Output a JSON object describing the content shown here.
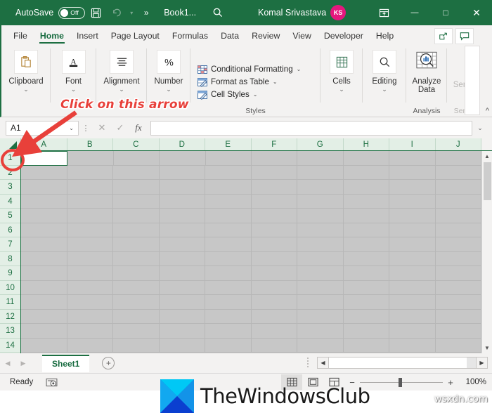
{
  "titlebar": {
    "autosave_label": "AutoSave",
    "autosave_state": "Off",
    "save_icon": "save-icon",
    "undo_icon": "undo-icon",
    "more_icon": "more-commands-icon",
    "document_name": "Book1...",
    "search_icon": "search-icon",
    "user_name": "Komal Srivastava",
    "avatar_initials": "KS",
    "avatar_color": "#e5177e",
    "ribbon_display_icon": "ribbon-display-options-icon",
    "minimize": "—",
    "maximize": "□",
    "close": "✕",
    "background": "#1d6f42"
  },
  "tabs": [
    {
      "label": "File",
      "active": false
    },
    {
      "label": "Home",
      "active": true
    },
    {
      "label": "Insert",
      "active": false
    },
    {
      "label": "Page Layout",
      "active": false
    },
    {
      "label": "Formulas",
      "active": false
    },
    {
      "label": "Data",
      "active": false
    },
    {
      "label": "Review",
      "active": false
    },
    {
      "label": "View",
      "active": false
    },
    {
      "label": "Developer",
      "active": false
    },
    {
      "label": "Help",
      "active": false
    }
  ],
  "tabbar_actions": [
    {
      "name": "share-button",
      "icon": "share-icon"
    },
    {
      "name": "comments-button",
      "icon": "comment-icon"
    }
  ],
  "ribbon": {
    "groups": [
      {
        "label": "Clipboard",
        "icon": "clipboard-icon",
        "group_name": "",
        "chevron": "⌄"
      },
      {
        "label": "Font",
        "icon": "font-a-icon",
        "group_name": "",
        "chevron": "⌄"
      },
      {
        "label": "Alignment",
        "icon": "alignment-icon",
        "group_name": "",
        "chevron": "⌄"
      },
      {
        "label": "Number",
        "icon": "percent-icon",
        "group_name": "",
        "chevron": "⌄"
      }
    ],
    "styles": {
      "group_name": "Styles",
      "items": [
        {
          "label": "Conditional Formatting",
          "icon": "conditional-formatting-icon",
          "chevron": "⌄"
        },
        {
          "label": "Format as Table",
          "icon": "format-as-table-icon",
          "chevron": "⌄"
        },
        {
          "label": "Cell Styles",
          "icon": "cell-styles-icon",
          "chevron": "⌄"
        }
      ]
    },
    "cells": {
      "label": "Cells",
      "icon": "cells-icon",
      "chevron": "⌄"
    },
    "editing": {
      "label": "Editing",
      "icon": "editing-find-icon",
      "chevron": "⌄"
    },
    "analysis": {
      "label": "Analyze Data",
      "icon": "analyze-data-icon",
      "group_name": "Analysis"
    },
    "sensitivity": {
      "label": "Sen",
      "group_name": "Sen",
      "overflow_chevron": "›"
    },
    "collapse_icon": "collapse-ribbon-icon"
  },
  "annotation": {
    "text": "Click on this arrow",
    "color": "#e8403a",
    "arrow": "red-arrow-pointing-to-select-all",
    "highlight": "red-ellipse-around-select-all-button"
  },
  "formulabar": {
    "namebox_value": "A1",
    "namebox_chevron": "⌄",
    "cancel_icon": "cancel-icon",
    "confirm_icon": "confirm-check-icon",
    "function_icon": "fx",
    "formula_value": "",
    "expand_chevron": "⌄"
  },
  "grid": {
    "select_all_icon": "select-all-corner-triangle",
    "columns": [
      "A",
      "B",
      "C",
      "D",
      "E",
      "F",
      "G",
      "H",
      "I",
      "J"
    ],
    "rows": [
      "1",
      "2",
      "3",
      "4",
      "5",
      "6",
      "7",
      "8",
      "9",
      "10",
      "11",
      "12",
      "13",
      "14"
    ],
    "active_cell": "A1",
    "cell_fill": "#c7c7c7",
    "header_fill": "#e3efe6",
    "header_text_color": "#1d6f42",
    "vscroll_up": "▲",
    "vscroll_down": "▼"
  },
  "watermark": {
    "logo_text": "TheWindowsClub",
    "site_text": "wsxdn.com"
  },
  "sheetbar": {
    "prev_icon": "◀",
    "next_icon": "▶",
    "sheets": [
      {
        "label": "Sheet1",
        "active": true
      }
    ],
    "add_sheet_icon": "+",
    "hscroll_left": "◀",
    "hscroll_right": "▶"
  },
  "statusbar": {
    "status": "Ready",
    "record_macro_icon": "record-macro-icon",
    "views": [
      {
        "name": "normal-view-button",
        "icon": "normal-view-icon",
        "selected": true
      },
      {
        "name": "page-layout-view-button",
        "icon": "page-layout-icon",
        "selected": false
      },
      {
        "name": "page-break-view-button",
        "icon": "page-break-icon",
        "selected": false
      }
    ],
    "zoom_out": "−",
    "zoom_in": "+",
    "zoom_level": "100%"
  }
}
